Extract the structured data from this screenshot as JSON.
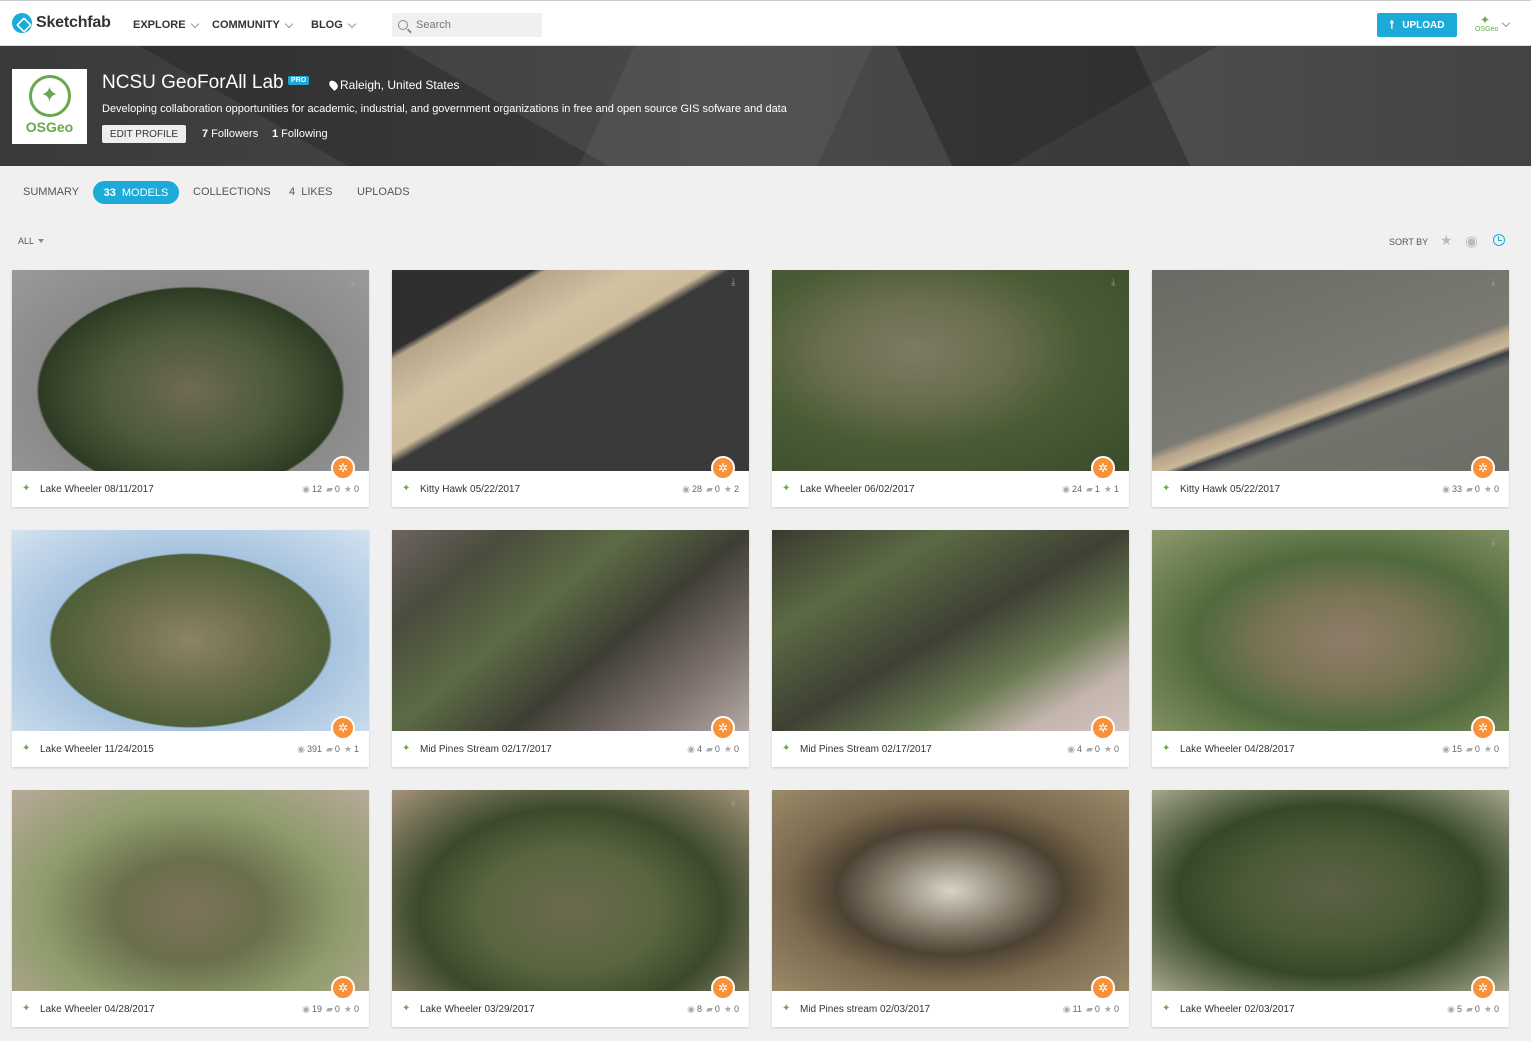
{
  "topnav": {
    "logo": "Sketchfab",
    "items": [
      {
        "label": "EXPLORE"
      },
      {
        "label": "COMMUNITY"
      },
      {
        "label": "BLOG"
      }
    ],
    "search_placeholder": "Search",
    "upload_label": "UPLOAD",
    "user_avatar_text": "OSGeo"
  },
  "profile": {
    "logo_text": "OSGeo",
    "name": "NCSU GeoForAll Lab",
    "badge": "PRO",
    "location": "Raleigh, United States",
    "bio": "Developing collaboration opportunities for academic, industrial, and government organizations in free and open source GIS sofware and data",
    "edit_label": "EDIT PROFILE",
    "followers_count": "7",
    "followers_label": "Followers",
    "following_count": "1",
    "following_label": "Following"
  },
  "tabs": {
    "summary": "SUMMARY",
    "models_count": "33",
    "models_label": "MODELS",
    "collections": "COLLECTIONS",
    "likes_count": "4",
    "likes_label": "LIKES",
    "uploads": "UPLOADS"
  },
  "filter": {
    "label": "ALL"
  },
  "sort": {
    "label": "SORT BY"
  },
  "accent_color": "#1caad9",
  "badge_color": "#f7923a",
  "models": [
    {
      "title": "Lake Wheeler 08/11/2017",
      "views": "12",
      "comments": "0",
      "likes": "0"
    },
    {
      "title": "Kitty Hawk 05/22/2017",
      "views": "28",
      "comments": "0",
      "likes": "2"
    },
    {
      "title": "Lake Wheeler 06/02/2017",
      "views": "24",
      "comments": "1",
      "likes": "1"
    },
    {
      "title": "Kitty Hawk 05/22/2017",
      "views": "33",
      "comments": "0",
      "likes": "0"
    },
    {
      "title": "Lake Wheeler 11/24/2015",
      "views": "391",
      "comments": "0",
      "likes": "1"
    },
    {
      "title": "Mid Pines Stream 02/17/2017",
      "views": "4",
      "comments": "0",
      "likes": "0"
    },
    {
      "title": "Mid Pines Stream 02/17/2017",
      "views": "4",
      "comments": "0",
      "likes": "0"
    },
    {
      "title": "Lake Wheeler 04/28/2017",
      "views": "15",
      "comments": "0",
      "likes": "0"
    },
    {
      "title": "Lake Wheeler 04/28/2017",
      "views": "19",
      "comments": "0",
      "likes": "0"
    },
    {
      "title": "Lake Wheeler 03/29/2017",
      "views": "8",
      "comments": "0",
      "likes": "0"
    },
    {
      "title": "Mid Pines stream 02/03/2017",
      "views": "11",
      "comments": "0",
      "likes": "0"
    },
    {
      "title": "Lake Wheeler 02/03/2017",
      "views": "5",
      "comments": "0",
      "likes": "0"
    }
  ]
}
